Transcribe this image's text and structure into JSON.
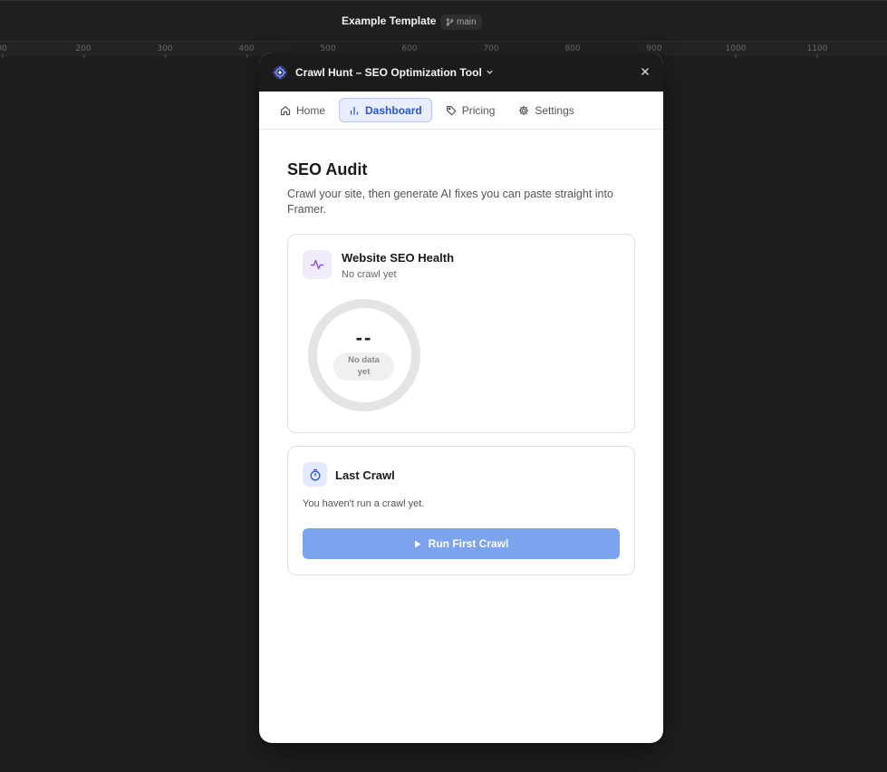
{
  "app": {
    "project_title": "Example Template",
    "separator": "·",
    "branch": "main"
  },
  "ruler": {
    "ticks": [
      "00",
      "200",
      "300",
      "400",
      "500",
      "600",
      "700",
      "800",
      "900",
      "1000",
      "1100"
    ]
  },
  "plugin": {
    "title": "Crawl Hunt – SEO Optimization Tool",
    "tabs": [
      {
        "label": "Home",
        "icon": "home-icon",
        "active": false
      },
      {
        "label": "Dashboard",
        "icon": "bar-chart-icon",
        "active": true
      },
      {
        "label": "Pricing",
        "icon": "tag-icon",
        "active": false
      },
      {
        "label": "Settings",
        "icon": "gear-icon",
        "active": false
      }
    ]
  },
  "audit": {
    "title": "SEO Audit",
    "subtitle": "Crawl your site, then generate AI fixes you can paste straight into Framer."
  },
  "health_card": {
    "title": "Website SEO Health",
    "subtitle": "No crawl yet",
    "score": "--",
    "status_line1": "No data",
    "status_line2": "yet"
  },
  "last_crawl_card": {
    "title": "Last Crawl",
    "message": "You haven't run a crawl yet.",
    "button_label": "Run First Crawl"
  },
  "colors": {
    "accent": "#2b55d6",
    "button": "#7ba3ee",
    "purple_icon": "#8a57d9"
  }
}
